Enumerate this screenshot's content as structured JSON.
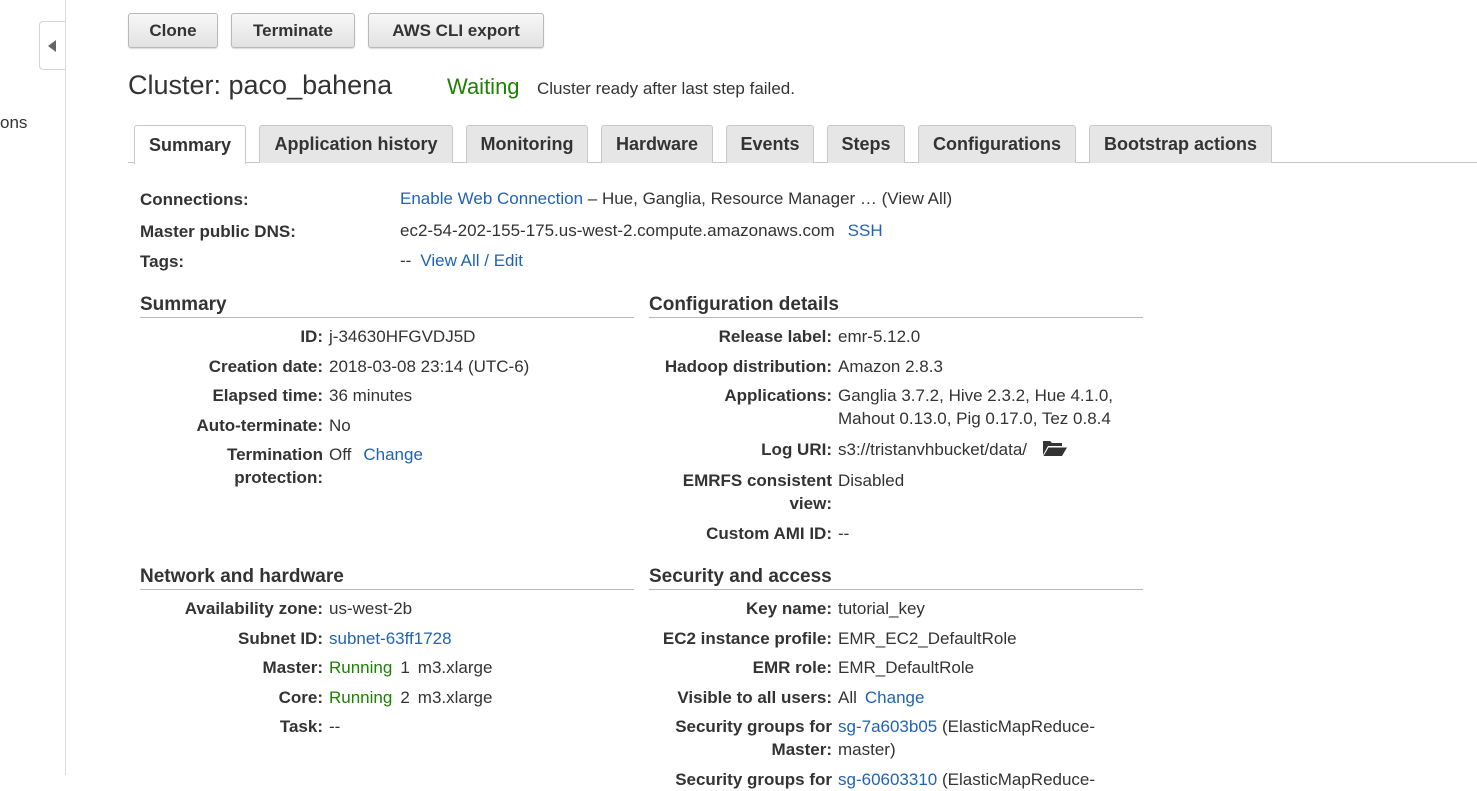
{
  "sidebar": {
    "partial_label": "ons"
  },
  "toolbar": {
    "clone": "Clone",
    "terminate": "Terminate",
    "cli_export": "AWS CLI export"
  },
  "cluster": {
    "title": "Cluster: paco_bahena",
    "status": "Waiting",
    "status_message": "Cluster ready after last step failed."
  },
  "tabs": [
    "Summary",
    "Application history",
    "Monitoring",
    "Hardware",
    "Events",
    "Steps",
    "Configurations",
    "Bootstrap actions"
  ],
  "info": {
    "connections_label": "Connections:",
    "connections_link": "Enable Web Connection",
    "connections_rest": " – Hue, Ganglia, Resource Manager … (View All)",
    "dns_label": "Master public DNS:",
    "dns_value": "ec2-54-202-155-175.us-west-2.compute.amazonaws.com",
    "ssh_link": "SSH",
    "tags_label": "Tags:",
    "tags_value": "--",
    "tags_link": "View All / Edit"
  },
  "summary": {
    "heading": "Summary",
    "id_label": "ID:",
    "id_value": "j-34630HFGVDJ5D",
    "creation_label": "Creation date:",
    "creation_value": "2018-03-08 23:14 (UTC-6)",
    "elapsed_label": "Elapsed time:",
    "elapsed_value": "36 minutes",
    "autoterm_label": "Auto-terminate:",
    "autoterm_value": "No",
    "termprot_label": "Termination protection:",
    "termprot_value": "Off",
    "termprot_link": "Change"
  },
  "config": {
    "heading": "Configuration details",
    "release_label": "Release label:",
    "release_value": "emr-5.12.0",
    "hadoop_label": "Hadoop distribution:",
    "hadoop_value": "Amazon 2.8.3",
    "apps_label": "Applications:",
    "apps_value": "Ganglia 3.7.2, Hive 2.3.2, Hue 4.1.0, Mahout 0.13.0, Pig 0.17.0, Tez 0.8.4",
    "log_label": "Log URI:",
    "log_value": "s3://tristanvhbucket/data/",
    "emrfs_label": "EMRFS consistent view:",
    "emrfs_value": "Disabled",
    "ami_label": "Custom AMI ID:",
    "ami_value": "--"
  },
  "network": {
    "heading": "Network and hardware",
    "az_label": "Availability zone:",
    "az_value": "us-west-2b",
    "subnet_label": "Subnet ID:",
    "subnet_value": "subnet-63ff1728",
    "master_label": "Master:",
    "master_status": "Running",
    "master_count": "1",
    "master_type": "m3.xlarge",
    "core_label": "Core:",
    "core_status": "Running",
    "core_count": "2",
    "core_type": "m3.xlarge",
    "task_label": "Task:",
    "task_value": "--"
  },
  "security": {
    "heading": "Security and access",
    "key_label": "Key name:",
    "key_value": "tutorial_key",
    "ec2_label": "EC2 instance profile:",
    "ec2_value": "EMR_EC2_DefaultRole",
    "emrrole_label": "EMR role:",
    "emrrole_value": "EMR_DefaultRole",
    "visible_label": "Visible to all users:",
    "visible_value": "All",
    "visible_link": "Change",
    "sgmaster_label": "Security groups for Master:",
    "sgmaster_link": "sg-7a603b05",
    "sgmaster_rest": " (ElasticMapReduce-master)",
    "sgcore_label": "Security groups for",
    "sgcore_link": "sg-60603310",
    "sgcore_rest": " (ElasticMapReduce-"
  },
  "colors": {
    "link": "#1f63b5",
    "status_green": "#1d8102",
    "text": "#333333"
  },
  "icons": {
    "collapse": "caret-left-icon",
    "log_folder": "folder-open-icon"
  }
}
